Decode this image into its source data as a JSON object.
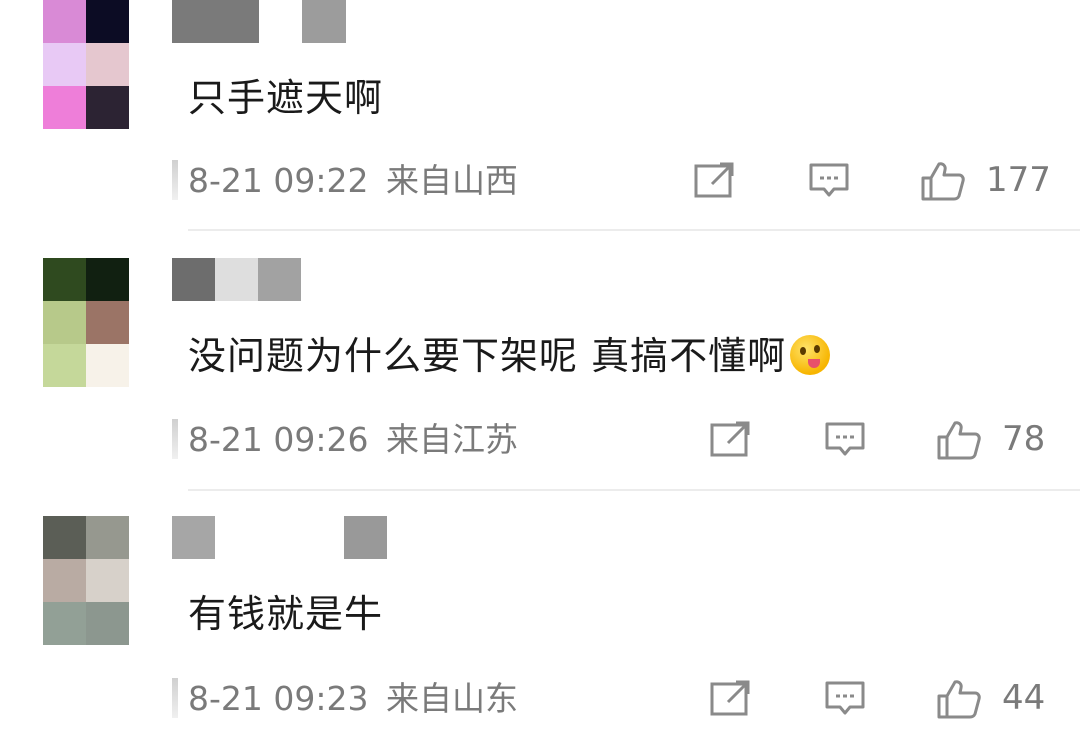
{
  "comments": [
    {
      "text": "只手遮天啊",
      "time": "8-21 09:22",
      "location": "来自山西",
      "likes": "177",
      "has_emoji": false,
      "avatar_colors": [
        "#d98ad6",
        "#0c0c24",
        "#e8c9f5",
        "#e5c7cf",
        "#ee7ed9",
        "#2c2333"
      ],
      "name_colors": [
        "#7a7a7a",
        "#9c9c9c"
      ]
    },
    {
      "text": "没问题为什么要下架呢 真搞不懂啊",
      "time": "8-21 09:26",
      "location": "来自江苏",
      "likes": "78",
      "has_emoji": true,
      "avatar_colors": [
        "#2f4a1f",
        "#112011",
        "#b7c98a",
        "#9b7466",
        "#c5d89a",
        "#f7f2e9"
      ],
      "name_colors": [
        "#6d6d6d",
        "#dedede",
        "#a2a2a2"
      ]
    },
    {
      "text": "有钱就是牛",
      "time": "8-21 09:23",
      "location": "来自山东",
      "likes": "44",
      "has_emoji": false,
      "avatar_colors": [
        "#5b5e56",
        "#96988f",
        "#b9aba3",
        "#d7d1ca",
        "#92a096",
        "#8c978f"
      ],
      "name_colors": [
        "#a6a6a6",
        "#999999"
      ]
    }
  ],
  "icons": {
    "share": "share-icon",
    "comment": "comment-icon",
    "like": "thumbs-up-icon"
  },
  "colors": {
    "meta_text": "#7a7a7a",
    "body_text": "#1a1a1a",
    "divider": "#ececec"
  }
}
